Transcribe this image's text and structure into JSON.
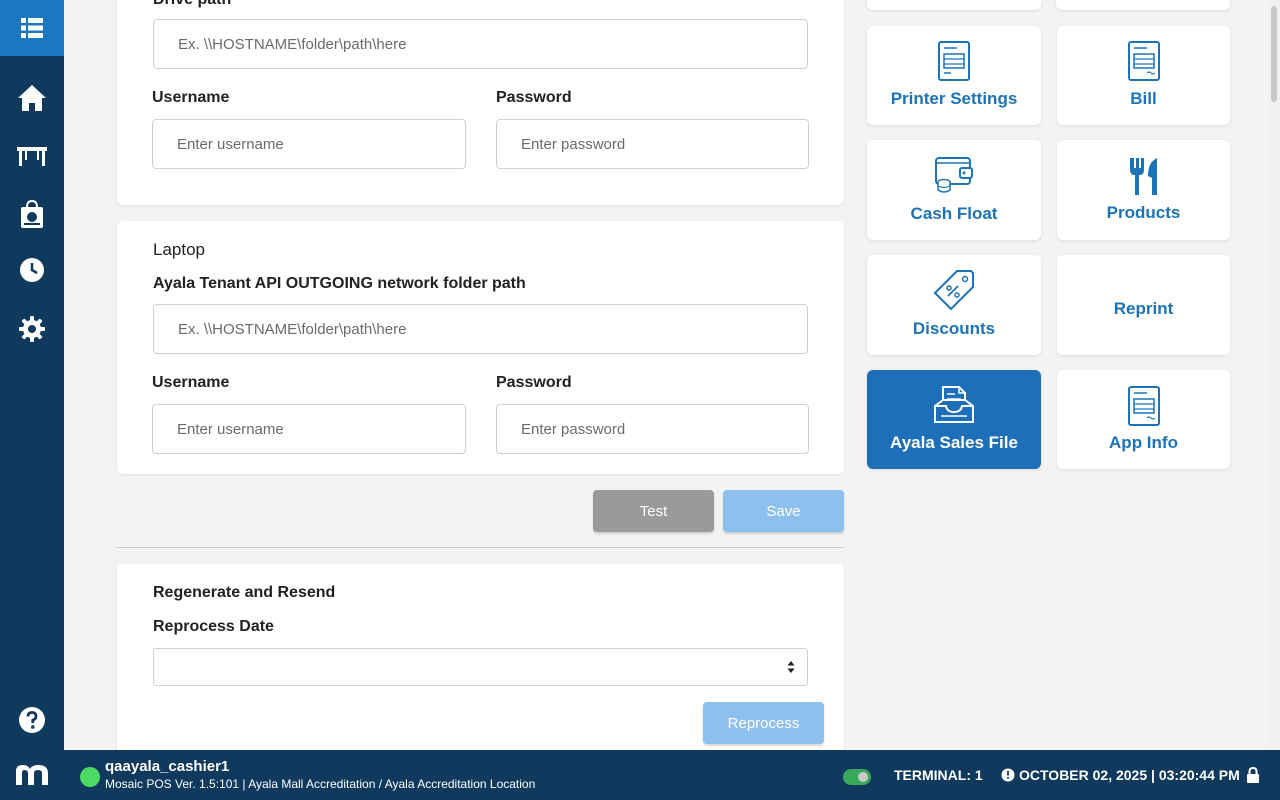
{
  "colors": {
    "sidebar": "#0f3a5e",
    "sidebar_top": "#1a78c2",
    "accent": "#1d73b8",
    "active_tile": "#1d6fba",
    "test_button": "#9a9a9a",
    "save_button": "#8ec0ee",
    "online": "#4cd964"
  },
  "sidebar": {
    "items": [
      {
        "icon": "grid-menu-icon"
      },
      {
        "icon": "home-icon"
      },
      {
        "icon": "table-icon"
      },
      {
        "icon": "takeout-bag-icon"
      },
      {
        "icon": "clock-icon"
      },
      {
        "icon": "gear-icon"
      },
      {
        "icon": "help-icon"
      }
    ]
  },
  "drive": {
    "path_label": "Drive path",
    "path_placeholder": "Ex. \\\\HOSTNAME\\folder\\path\\here",
    "username_label": "Username",
    "username_placeholder": "Enter username",
    "password_label": "Password",
    "password_placeholder": "Enter password"
  },
  "laptop": {
    "title": "Laptop",
    "path_label": "Ayala Tenant API OUTGOING network folder path",
    "path_placeholder": "Ex. \\\\HOSTNAME\\folder\\path\\here",
    "username_label": "Username",
    "username_placeholder": "Enter username",
    "password_label": "Password",
    "password_placeholder": "Enter password"
  },
  "actions": {
    "test_label": "Test",
    "save_label": "Save"
  },
  "regenerate": {
    "title": "Regenerate and Resend",
    "date_label": "Reprocess Date",
    "date_value": "",
    "reprocess_label": "Reprocess"
  },
  "tiles": [
    {
      "label": "Printer Settings",
      "icon": "printer-doc-icon",
      "active": false
    },
    {
      "label": "Bill",
      "icon": "bill-doc-icon",
      "active": false
    },
    {
      "label": "Cash Float",
      "icon": "wallet-coins-icon",
      "active": false
    },
    {
      "label": "Products",
      "icon": "fork-knife-icon",
      "active": false
    },
    {
      "label": "Discounts",
      "icon": "discount-tag-icon",
      "active": false
    },
    {
      "label": "Reprint",
      "icon": "",
      "active": false
    },
    {
      "label": "Ayala Sales File",
      "icon": "inbox-file-icon",
      "active": true
    },
    {
      "label": "App Info",
      "icon": "info-doc-icon",
      "active": false
    }
  ],
  "footer": {
    "username": "qaayala_cashier1",
    "version_line": "Mosaic POS Ver. 1.5:101 | Ayala Mall Accreditation / Ayala Accreditation Location",
    "terminal": "TERMINAL: 1",
    "datetime": "OCTOBER 02, 2025 | 03:20:44 PM"
  }
}
